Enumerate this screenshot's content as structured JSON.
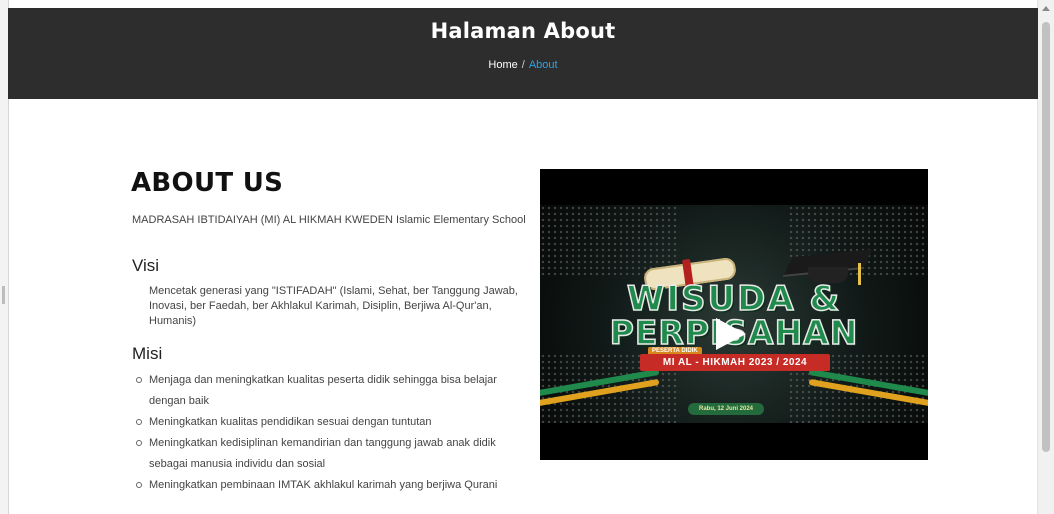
{
  "hero": {
    "title": "Halaman About",
    "breadcrumb": {
      "home": "Home",
      "separator": "/",
      "current": "About"
    }
  },
  "about": {
    "heading": "ABOUT US",
    "school_description": "MADRASAH IBTIDAIYAH (MI) AL HIKMAH KWEDEN Islamic Elementary School",
    "visi": {
      "title": "Visi",
      "text": "Mencetak generasi yang \"ISTIFADAH\" (Islami, Sehat, ber Tanggung Jawab, Inovasi, ber Faedah, ber Akhlakul Karimah, Disiplin, Berjiwa Al-Qur'an, Humanis)"
    },
    "misi": {
      "title": "Misi",
      "items": [
        "Menjaga dan meningkatkan kualitas peserta didik sehingga bisa belajar dengan baik",
        "Meningkatkan kualitas pendidikan sesuai dengan tuntutan",
        "Meningkatkan kedisiplinan kemandirian dan tanggung jawab anak didik sebagai manusia individu dan sosial",
        "Meningkatkan pembinaan IMTAK akhlakul karimah yang berjiwa Qurani"
      ]
    }
  },
  "video": {
    "thumbnail_text": {
      "line1": "WISUDA &",
      "line2": "PERPISAHAN",
      "tag": "PESERTA DIDIK",
      "event": "MI AL - HIKMAH 2023 / 2024",
      "date": "Rabu, 12 Juni 2024"
    },
    "play_icon": "play-icon"
  },
  "colors": {
    "hero_bg": "#2d2d2d",
    "breadcrumb_active": "#2aa6e6",
    "video_bg": "#000000"
  }
}
